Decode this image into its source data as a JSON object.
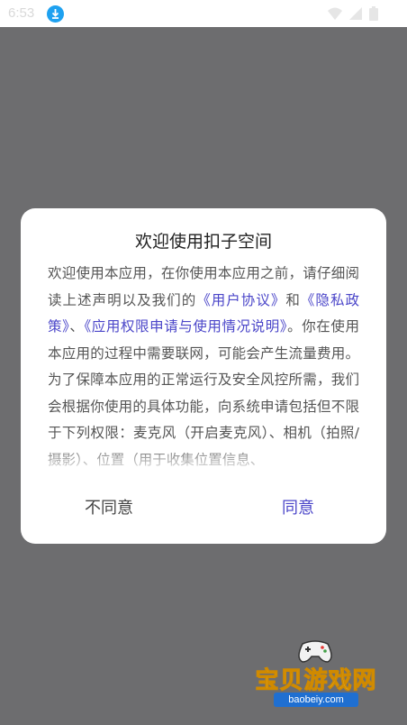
{
  "status_bar": {
    "time": "6:53",
    "icons": [
      "download-icon",
      "wifi-icon",
      "signal-icon",
      "battery-icon"
    ]
  },
  "dialog": {
    "title": "欢迎使用扣子空间",
    "body": {
      "before_links": "欢迎使用本应用，在你使用本应用之前，请仔细阅读上述声明以及我们的",
      "link_user": "《用户协议》",
      "and": "和",
      "link_privacy": "《隐私政策》",
      "sep": "、",
      "link_permissions": "《应用权限申请与使用情况说明》",
      "after_links": "。你在使用本应用的过程中需要联网，可能会产生流量费用。为了保障本应用的正常运行及安全风控所需，我们会根据你使用的具体功能，向系统申请包括但不限于下列权限：麦克风（开启麦克风）、相机（拍照/摄影）、位置（用于收集位置信息、"
    },
    "disagree_label": "不同意",
    "agree_label": "同意"
  },
  "watermark": {
    "text": "宝贝游戏网",
    "url": "baobeiy.com"
  },
  "colors": {
    "overlay": "#6d6d6f",
    "link": "#4b46c9",
    "agree": "#4b46c9",
    "dialog_bg": "#ffffff"
  }
}
